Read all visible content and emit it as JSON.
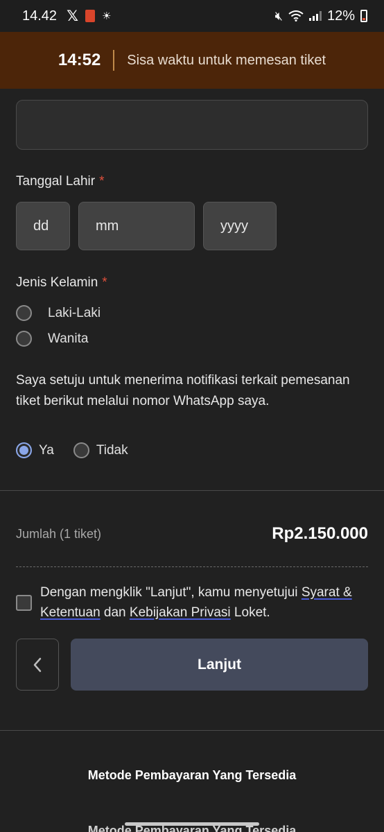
{
  "status_bar": {
    "time": "14.42",
    "battery": "12%"
  },
  "timer": {
    "time": "14:52",
    "label": "Sisa waktu untuk memesan tiket"
  },
  "form": {
    "birth_date_label": "Tanggal Lahir",
    "required_mark": "*",
    "day_placeholder": "dd",
    "month_placeholder": "mm",
    "year_placeholder": "yyyy",
    "gender_label": "Jenis Kelamin",
    "gender_options": [
      "Laki-Laki",
      "Wanita"
    ],
    "whatsapp_consent": "Saya setuju untuk menerima notifikasi terkait pemesanan tiket berikut melalui nomor WhatsApp saya.",
    "whatsapp_options": [
      "Ya",
      "Tidak"
    ],
    "whatsapp_selected": "Ya"
  },
  "summary": {
    "total_label": "Jumlah (1 tiket)",
    "total_value": "Rp2.150.000"
  },
  "terms": {
    "prefix": "Dengan mengklik \"Lanjut\", kamu menyetujui ",
    "link_terms": "Syarat & Ketentuan",
    "middle": " dan ",
    "link_privacy": "Kebijakan Privasi",
    "suffix": " Loket."
  },
  "actions": {
    "continue_label": "Lanjut"
  },
  "payment": {
    "title": "Metode Pembayaran Yang Tersedia"
  },
  "colors": {
    "timer_bg": "#4c2509",
    "required": "#e0503c",
    "radio_selected": "#8aa6e8",
    "continue_bg": "#444a5c"
  }
}
